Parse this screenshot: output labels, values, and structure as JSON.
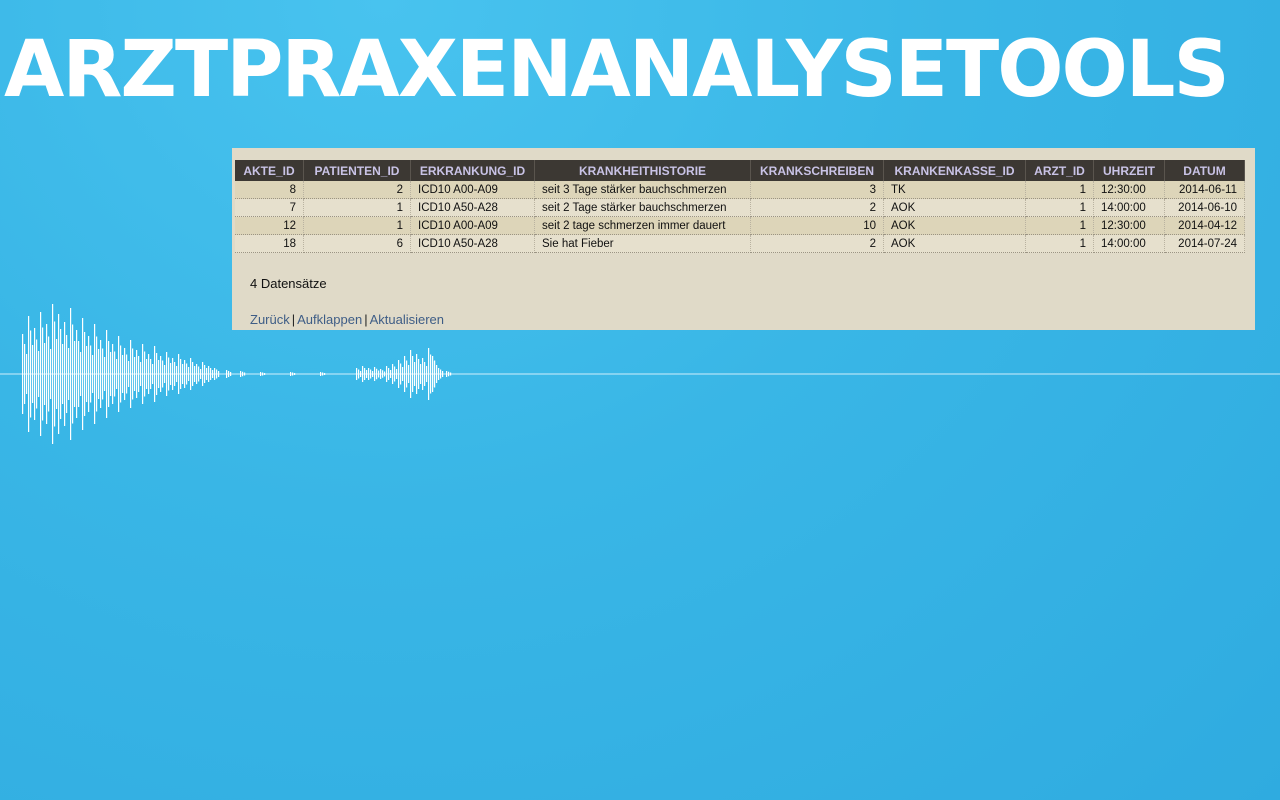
{
  "title": "ARZTPRAXENANALYSETOOLS",
  "table": {
    "columns": [
      "AKTE_ID",
      "PATIENTEN_ID",
      "ERKRANKUNG_ID",
      "KRANKHEITHISTORIE",
      "KRANKSCHREIBEN",
      "KRANKENKASSE_ID",
      "ARZT_ID",
      "UHRZEIT",
      "DATUM"
    ],
    "rows": [
      [
        "8",
        "2",
        "ICD10 A00-A09",
        "seit 3 Tage stärker bauchschmerzen",
        "3",
        "TK",
        "1",
        "12:30:00",
        "2014-06-11"
      ],
      [
        "7",
        "1",
        "ICD10 A50-A28",
        "seit 2 Tage stärker bauchschmerzen",
        "2",
        "AOK",
        "1",
        "14:00:00",
        "2014-06-10"
      ],
      [
        "12",
        "1",
        "ICD10 A00-A09",
        "seit 2 tage schmerzen immer dauert",
        "10",
        "AOK",
        "1",
        "12:30:00",
        "2014-04-12"
      ],
      [
        "18",
        "6",
        "ICD10 A50-A28",
        "Sie hat Fieber",
        "2",
        "AOK",
        "1",
        "14:00:00",
        "2014-07-24"
      ]
    ]
  },
  "record_count": "4 Datensätze",
  "links": {
    "back": "Zurück",
    "expand": "Aufklappen",
    "refresh": "Aktualisieren",
    "separator": "|"
  },
  "colors": {
    "background": "#39b6e6",
    "panel": "#e0dac8",
    "header": "#3c3833",
    "header_text": "#c9c3e6",
    "link": "#3e5d86"
  }
}
